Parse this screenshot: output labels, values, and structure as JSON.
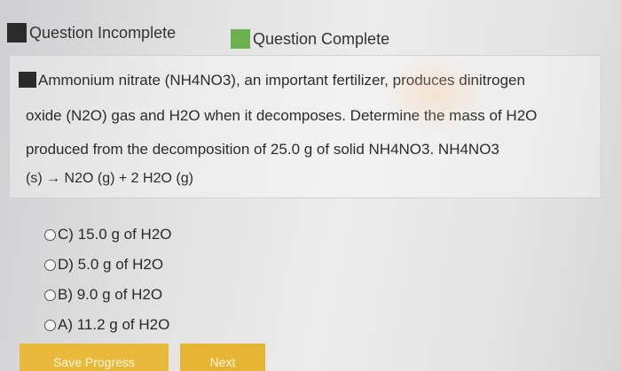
{
  "legend": {
    "incomplete_label": "Question Incomplete",
    "complete_label": "Question Complete",
    "incomplete_color": "#2b2b2b",
    "complete_color": "#6ab04c"
  },
  "question": {
    "line1": "Ammonium nitrate (NH4NO3), an important fertilizer, produces dinitrogen",
    "line2": "oxide (N2O) gas and H2O when it decomposes. Determine the mass of H2O",
    "line3": "produced from the decomposition of 25.0 g of solid NH4NO3. NH4NO3",
    "line4": "(s) → N2O (g) + 2 H2O (g)"
  },
  "options": [
    {
      "label": "C) 15.0 g of H2O"
    },
    {
      "label": "D) 5.0 g of H2O"
    },
    {
      "label": "B) 9.0 g of H2O"
    },
    {
      "label": "A) 11.2 g of H2O"
    }
  ],
  "footer": {
    "save_label": "Save Progress",
    "next_label": "Next",
    "button_color": "#e8b93a"
  }
}
